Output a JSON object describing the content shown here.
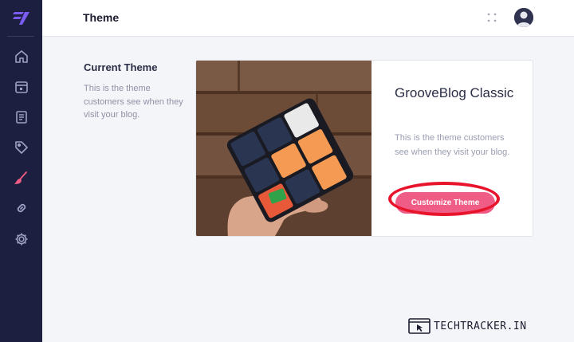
{
  "header": {
    "title": "Theme"
  },
  "sidebar": {
    "items": [
      {
        "icon": "home-icon"
      },
      {
        "icon": "calendar-icon"
      },
      {
        "icon": "posts-icon"
      },
      {
        "icon": "tag-icon"
      },
      {
        "icon": "brush-icon",
        "active": true
      },
      {
        "icon": "link-icon"
      },
      {
        "icon": "gear-icon"
      }
    ]
  },
  "current_theme": {
    "heading": "Current Theme",
    "description": "This is the theme customers see when they visit your blog."
  },
  "theme_card": {
    "name": "GrooveBlog Classic",
    "description": "This is the theme customers see when they visit your blog.",
    "button_label": "Customize Theme"
  },
  "watermark": {
    "text": "TECHTRACKER.IN"
  },
  "colors": {
    "sidebar_bg": "#1c1f3f",
    "accent": "#ef5d86",
    "highlight": "#e8142c"
  }
}
